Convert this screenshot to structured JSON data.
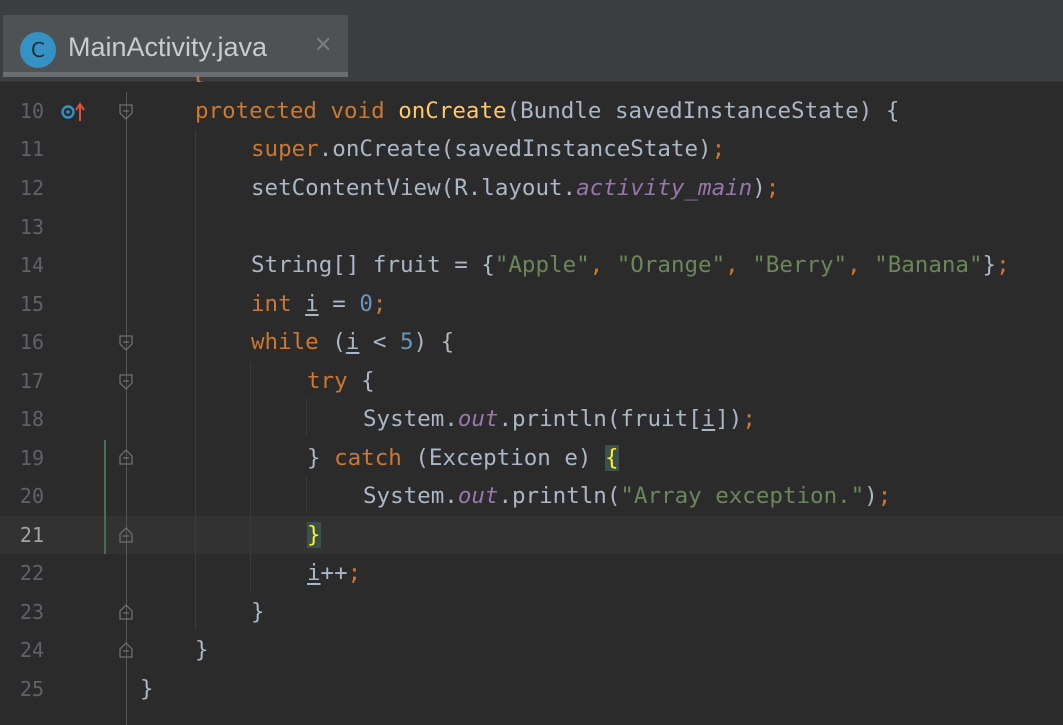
{
  "tab": {
    "icon_letter": "C",
    "title": "MainActivity.java",
    "close": "✕"
  },
  "editor": {
    "current_line": 21,
    "lines": [
      {
        "number": "10"
      },
      {
        "number": "11"
      },
      {
        "number": "12"
      },
      {
        "number": "13"
      },
      {
        "number": "14"
      },
      {
        "number": "15"
      },
      {
        "number": "16"
      },
      {
        "number": "17"
      },
      {
        "number": "18"
      },
      {
        "number": "19"
      },
      {
        "number": "20"
      },
      {
        "number": "21"
      },
      {
        "number": "22"
      },
      {
        "number": "23"
      },
      {
        "number": "24"
      },
      {
        "number": "25"
      }
    ],
    "tokens": {
      "l10": {
        "protected": "protected",
        "void": "void",
        "method": "onCreate",
        "params": "(Bundle savedInstanceState) {"
      },
      "l11": {
        "super": "super",
        "call": ".onCreate(savedInstanceState)",
        "semi": ";"
      },
      "l12": {
        "call": "setContentView(R.layout.",
        "field": "activity_main",
        "close": ")",
        "semi": ";"
      },
      "l14": {
        "decl": "String[] fruit = {",
        "s1": "\"Apple\"",
        "c1": ", ",
        "s2": "\"Orange\"",
        "c2": ", ",
        "s3": "\"Berry\"",
        "c3": ", ",
        "s4": "\"Banana\"",
        "end": "}",
        "semi": ";"
      },
      "l15": {
        "int": "int",
        "var": "i",
        "eq": " = ",
        "num": "0",
        "semi": ";"
      },
      "l16": {
        "while": "while",
        "open": " (",
        "var": "i",
        "lt": " < ",
        "num": "5",
        "close": ") {"
      },
      "l17": {
        "try": "try",
        "brace": " {"
      },
      "l18": {
        "sys": "System.",
        "out": "out",
        "println": ".println(fruit[",
        "var": "i",
        "close": "])",
        "semi": ";"
      },
      "l19": {
        "rbrace": "} ",
        "catch": "catch",
        "params": " (Exception e) ",
        "brace": "{"
      },
      "l20": {
        "sys": "System.",
        "out": "out",
        "println": ".println(",
        "str": "\"Array exception.\"",
        "close": ")",
        "semi": ";"
      },
      "l21": {
        "brace": "}"
      },
      "l22": {
        "var": "i",
        "inc": "++",
        "semi": ";"
      },
      "l23": {
        "brace": "}"
      },
      "l24": {
        "brace": "}"
      },
      "l25": {
        "brace": "}"
      }
    }
  }
}
